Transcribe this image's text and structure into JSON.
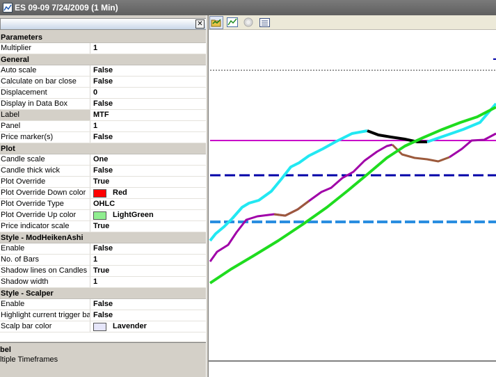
{
  "window": {
    "title": "ES 09-09  7/24/2009 (1 Min)"
  },
  "toolbar": {
    "icons": [
      "open-chart-icon",
      "chart-style-icon",
      "circle-disabled-icon",
      "data-box-icon"
    ]
  },
  "properties": [
    {
      "type": "cat",
      "label": "Parameters"
    },
    {
      "type": "row",
      "key": "Multiplier",
      "value": "1"
    },
    {
      "type": "cat",
      "label": "General"
    },
    {
      "type": "row",
      "key": "Auto scale",
      "value": "False"
    },
    {
      "type": "row",
      "key": "Calculate on bar close",
      "value": "False"
    },
    {
      "type": "row",
      "key": "Displacement",
      "value": "0"
    },
    {
      "type": "row",
      "key": "Display in Data Box",
      "value": "False"
    },
    {
      "type": "row",
      "key": "Label",
      "value": "MTF",
      "selected": true
    },
    {
      "type": "row",
      "key": "Panel",
      "value": "1"
    },
    {
      "type": "row",
      "key": "Price marker(s)",
      "value": "False"
    },
    {
      "type": "cat",
      "label": "Plot"
    },
    {
      "type": "row",
      "key": "Candle scale",
      "value": "One"
    },
    {
      "type": "row",
      "key": "Candle thick wick",
      "value": "False"
    },
    {
      "type": "row",
      "key": "Plot Override",
      "value": "True"
    },
    {
      "type": "row",
      "key": "Plot Override Down color",
      "value": "Red",
      "swatch": "#ff0000"
    },
    {
      "type": "row",
      "key": "Plot Override Type",
      "value": "OHLC"
    },
    {
      "type": "row",
      "key": "Plot Override Up color",
      "value": "LightGreen",
      "swatch": "#90ee90"
    },
    {
      "type": "row",
      "key": "Price indicator scale",
      "value": "True"
    },
    {
      "type": "cat",
      "label": "Style - ModHeikenAshi"
    },
    {
      "type": "row",
      "key": "Enable",
      "value": "False"
    },
    {
      "type": "row",
      "key": "No. of Bars",
      "value": "1"
    },
    {
      "type": "row",
      "key": "Shadow lines on Candles",
      "value": "True"
    },
    {
      "type": "row",
      "key": "Shadow width",
      "value": "1"
    },
    {
      "type": "cat",
      "label": "Style - Scalper"
    },
    {
      "type": "row",
      "key": "Enable",
      "value": "False"
    },
    {
      "type": "row",
      "key": "Highlight current trigger bar",
      "value": "False"
    },
    {
      "type": "row",
      "key": "Scalp bar color",
      "value": "Lavender",
      "swatch": "#e6e6fa"
    }
  ],
  "description": {
    "title": "bel",
    "text": "ltiple Timeframes"
  },
  "colors": {
    "cyan": "#22e8f2",
    "green": "#1fdc1f",
    "magenta": "#c800c8",
    "purple": "#a000a8",
    "brown": "#9c5a3c",
    "black": "#000000",
    "navy": "#0000a8",
    "blue": "#2a8ee0"
  }
}
